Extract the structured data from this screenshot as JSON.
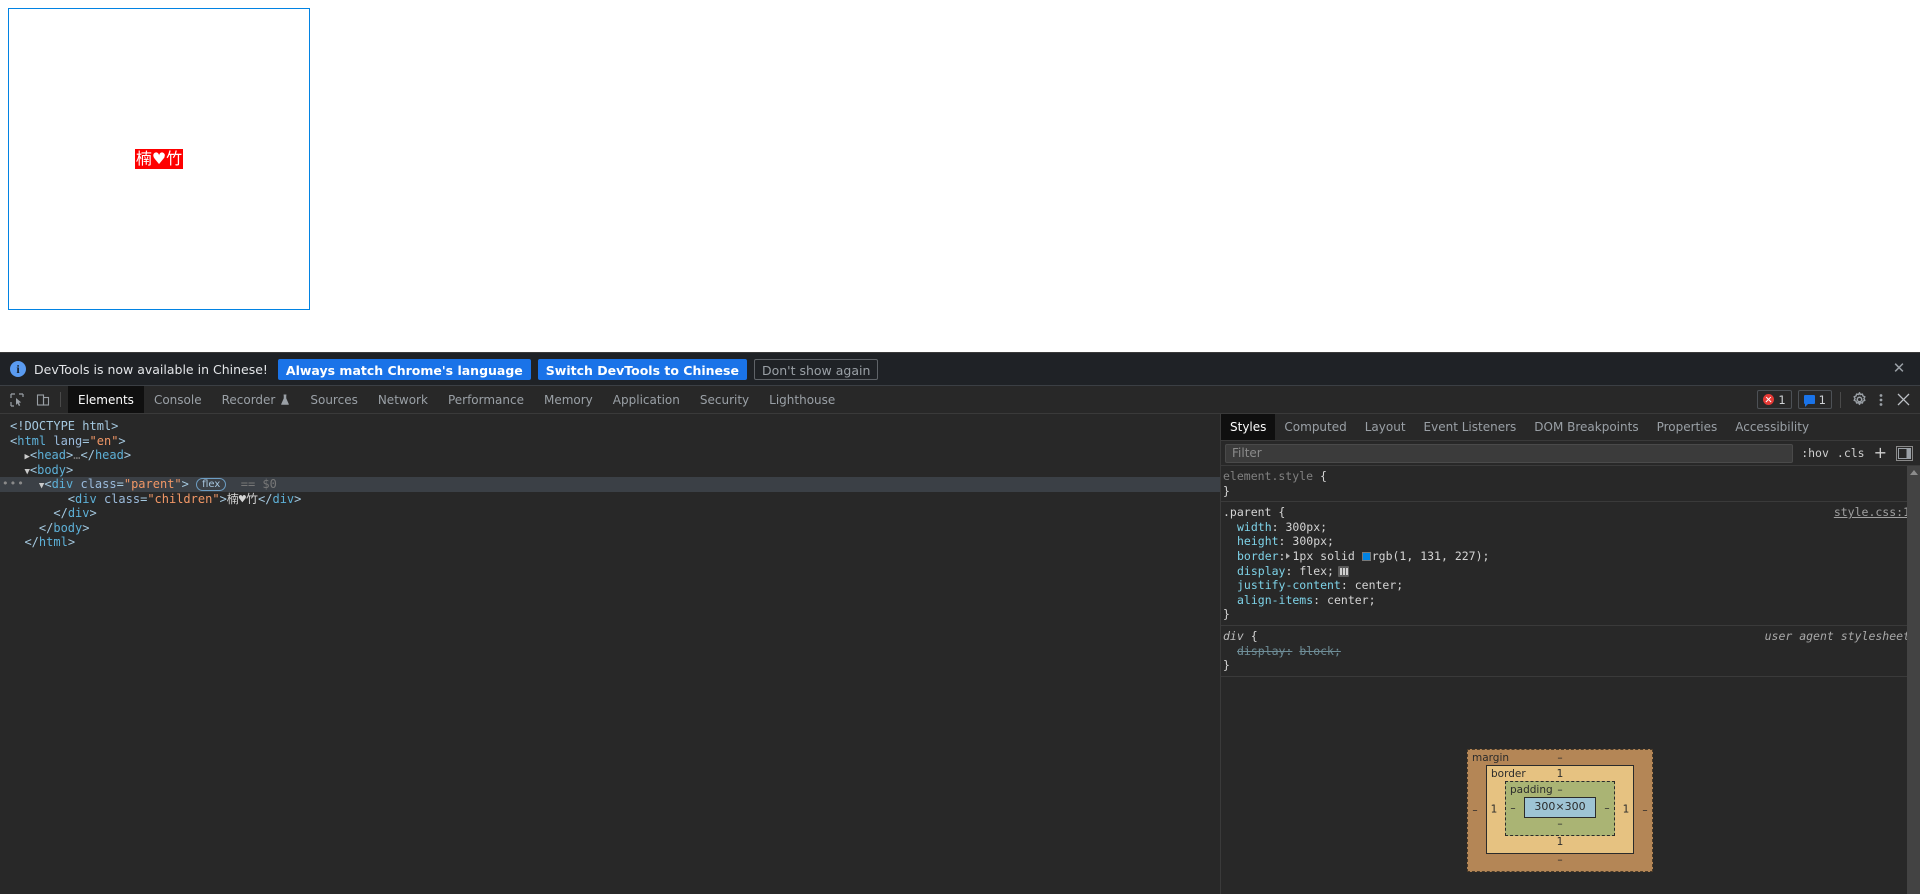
{
  "page": {
    "parent_class": "parent",
    "child_text": "楠♥竹",
    "border_color": "#0183e3",
    "child_bg": "#fe0000"
  },
  "infobar": {
    "icon": "info-icon",
    "message": "DevTools is now available in Chinese!",
    "btn_primary_1": "Always match Chrome's language",
    "btn_primary_2": "Switch DevTools to Chinese",
    "btn_plain": "Don't show again",
    "close": "✕"
  },
  "toolbar": {
    "inspect_icon": "inspect-element-icon",
    "device_icon": "device-toolbar-icon",
    "tabs": [
      {
        "label": "Elements",
        "active": true,
        "experimental": false
      },
      {
        "label": "Console",
        "active": false,
        "experimental": false
      },
      {
        "label": "Recorder",
        "active": false,
        "experimental": true
      },
      {
        "label": "Sources",
        "active": false,
        "experimental": false
      },
      {
        "label": "Network",
        "active": false,
        "experimental": false
      },
      {
        "label": "Performance",
        "active": false,
        "experimental": false
      },
      {
        "label": "Memory",
        "active": false,
        "experimental": false
      },
      {
        "label": "Application",
        "active": false,
        "experimental": false
      },
      {
        "label": "Security",
        "active": false,
        "experimental": false
      },
      {
        "label": "Lighthouse",
        "active": false,
        "experimental": false
      }
    ],
    "error_count": "1",
    "message_count": "1",
    "settings_icon": "gear-icon",
    "more_icon": "kebab-menu-icon",
    "close_icon": "close-icon"
  },
  "dom": {
    "rows": [
      {
        "id": "doctype",
        "indent": 0,
        "selected": false,
        "parts": [
          {
            "t": "punct",
            "v": "<!DOCTYPE html>"
          }
        ]
      },
      {
        "id": "html-open",
        "indent": 0,
        "selected": false,
        "parts": [
          {
            "t": "punct",
            "v": "<"
          },
          {
            "t": "tag",
            "v": "html"
          },
          {
            "t": "sp",
            "v": " "
          },
          {
            "t": "attr",
            "v": "lang"
          },
          {
            "t": "punct",
            "v": "="
          },
          {
            "t": "val",
            "v": "\"en\""
          },
          {
            "t": "punct",
            "v": ">"
          }
        ]
      },
      {
        "id": "head",
        "indent": 1,
        "selected": false,
        "collapsed": true,
        "parts": [
          {
            "t": "punct",
            "v": "<"
          },
          {
            "t": "tag",
            "v": "head"
          },
          {
            "t": "punct",
            "v": ">"
          },
          {
            "t": "dim",
            "v": "…"
          },
          {
            "t": "punct",
            "v": "</"
          },
          {
            "t": "tag",
            "v": "head"
          },
          {
            "t": "punct",
            "v": ">"
          }
        ]
      },
      {
        "id": "body-open",
        "indent": 1,
        "selected": false,
        "expanded": true,
        "parts": [
          {
            "t": "punct",
            "v": "<"
          },
          {
            "t": "tag",
            "v": "body"
          },
          {
            "t": "punct",
            "v": ">"
          }
        ]
      },
      {
        "id": "parent-div",
        "indent": 2,
        "selected": true,
        "expanded": true,
        "badge": "flex",
        "suffix": "== $0",
        "parts": [
          {
            "t": "punct",
            "v": "<"
          },
          {
            "t": "tag",
            "v": "div"
          },
          {
            "t": "sp",
            "v": " "
          },
          {
            "t": "attr",
            "v": "class"
          },
          {
            "t": "punct",
            "v": "="
          },
          {
            "t": "val",
            "v": "\"parent\""
          },
          {
            "t": "punct",
            "v": ">"
          }
        ]
      },
      {
        "id": "child-div",
        "indent": 4,
        "selected": false,
        "parts": [
          {
            "t": "punct",
            "v": "<"
          },
          {
            "t": "tag",
            "v": "div"
          },
          {
            "t": "sp",
            "v": " "
          },
          {
            "t": "attr",
            "v": "class"
          },
          {
            "t": "punct",
            "v": "="
          },
          {
            "t": "val",
            "v": "\"children\""
          },
          {
            "t": "punct",
            "v": ">"
          },
          {
            "t": "text",
            "v": "楠♥竹"
          },
          {
            "t": "punct",
            "v": "</"
          },
          {
            "t": "tag",
            "v": "div"
          },
          {
            "t": "punct",
            "v": ">"
          }
        ]
      },
      {
        "id": "parent-close",
        "indent": 3,
        "selected": false,
        "parts": [
          {
            "t": "punct",
            "v": "</"
          },
          {
            "t": "tag",
            "v": "div"
          },
          {
            "t": "punct",
            "v": ">"
          }
        ]
      },
      {
        "id": "body-close",
        "indent": 2,
        "selected": false,
        "parts": [
          {
            "t": "punct",
            "v": "</"
          },
          {
            "t": "tag",
            "v": "body"
          },
          {
            "t": "punct",
            "v": ">"
          }
        ]
      },
      {
        "id": "html-close",
        "indent": 1,
        "selected": false,
        "parts": [
          {
            "t": "punct",
            "v": "</"
          },
          {
            "t": "tag",
            "v": "html"
          },
          {
            "t": "punct",
            "v": ">"
          }
        ]
      }
    ]
  },
  "styles": {
    "tabs": [
      {
        "label": "Styles",
        "active": true
      },
      {
        "label": "Computed",
        "active": false
      },
      {
        "label": "Layout",
        "active": false
      },
      {
        "label": "Event Listeners",
        "active": false
      },
      {
        "label": "DOM Breakpoints",
        "active": false
      },
      {
        "label": "Properties",
        "active": false
      },
      {
        "label": "Accessibility",
        "active": false
      }
    ],
    "filter_placeholder": "Filter",
    "filter_value": "",
    "hov_label": ":hov",
    "cls_label": ".cls",
    "plus_label": "+",
    "rules": [
      {
        "selector": "element.style",
        "selector_style": "dim",
        "origin": "",
        "declarations": []
      },
      {
        "selector": ".parent",
        "selector_style": "name",
        "origin": "style.css:1",
        "origin_style": "link",
        "declarations": [
          {
            "prop": "width",
            "value": "300px"
          },
          {
            "prop": "height",
            "value": "300px"
          },
          {
            "prop": "border",
            "value": "1px solid rgb(1, 131, 227)",
            "swatch": "#0183e3",
            "expandable": true
          },
          {
            "prop": "display",
            "value": "flex",
            "flexbtn": true
          },
          {
            "prop": "justify-content",
            "value": "center"
          },
          {
            "prop": "align-items",
            "value": "center"
          }
        ]
      },
      {
        "selector": "div",
        "selector_style": "ua",
        "origin": "user agent stylesheet",
        "origin_style": "ua",
        "declarations": [
          {
            "prop": "display",
            "value": "block",
            "struck": true
          }
        ]
      }
    ]
  },
  "box_model": {
    "margin_label": "margin",
    "margin_top": "–",
    "margin_right": "–",
    "margin_bottom": "–",
    "margin_left": "–",
    "border_label": "border",
    "border_top": "1",
    "border_right": "1",
    "border_bottom": "1",
    "border_left": "1",
    "padding_label": "padding",
    "padding_top": "–",
    "padding_right": "–",
    "padding_bottom": "–",
    "padding_left": "–",
    "content": "300×300",
    "colors": {
      "margin": "#b48656",
      "border": "#e6c281",
      "padding": "#aab474",
      "content": "#9ec4d4"
    }
  }
}
